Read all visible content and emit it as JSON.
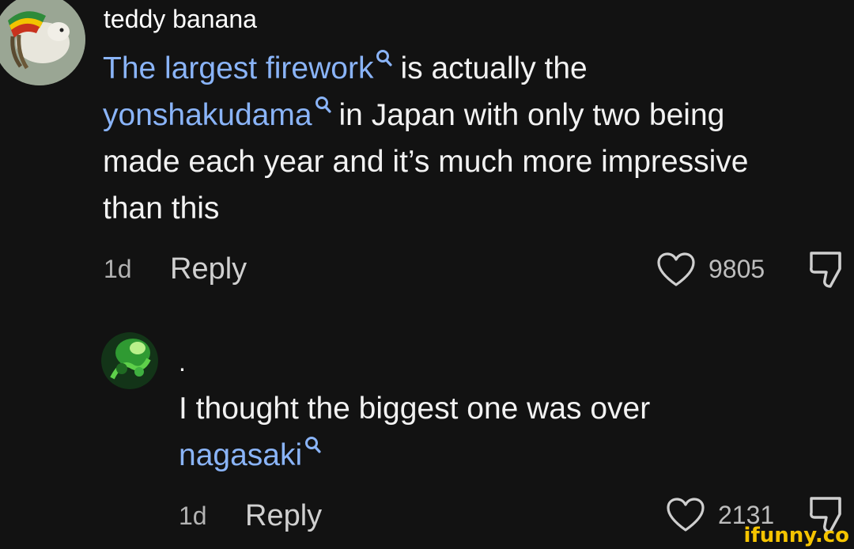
{
  "comments": [
    {
      "username": "teddy banana",
      "text_lines": [
        [
          {
            "text": "The largest firework",
            "link": true
          },
          {
            "text": "is actually the",
            "link": false
          }
        ],
        [
          {
            "text": "yonshakudama",
            "link": true
          },
          {
            "text": "in Japan with only two being",
            "link": false
          }
        ],
        [
          {
            "text": "made each year and it’s much more impressive",
            "link": false
          }
        ],
        [
          {
            "text": "than this",
            "link": false
          }
        ]
      ],
      "age": "1d",
      "reply_label": "Reply",
      "like_count": "9805"
    },
    {
      "username": ".",
      "text_lines": [
        [
          {
            "text": "I thought the biggest one was over",
            "link": false
          }
        ],
        [
          {
            "text": "nagasaki",
            "link": true
          }
        ]
      ],
      "age": "1d",
      "reply_label": "Reply",
      "like_count": "2131"
    }
  ],
  "watermark": "ifunny.co",
  "icons": {
    "like": "heart-outline-icon",
    "dislike": "thumbs-down-icon",
    "search_link": "magnifier-icon"
  },
  "colors": {
    "background": "#121212",
    "link": "#8ab4f8",
    "text": "#f2f2f2",
    "watermark": "#f5c400"
  }
}
